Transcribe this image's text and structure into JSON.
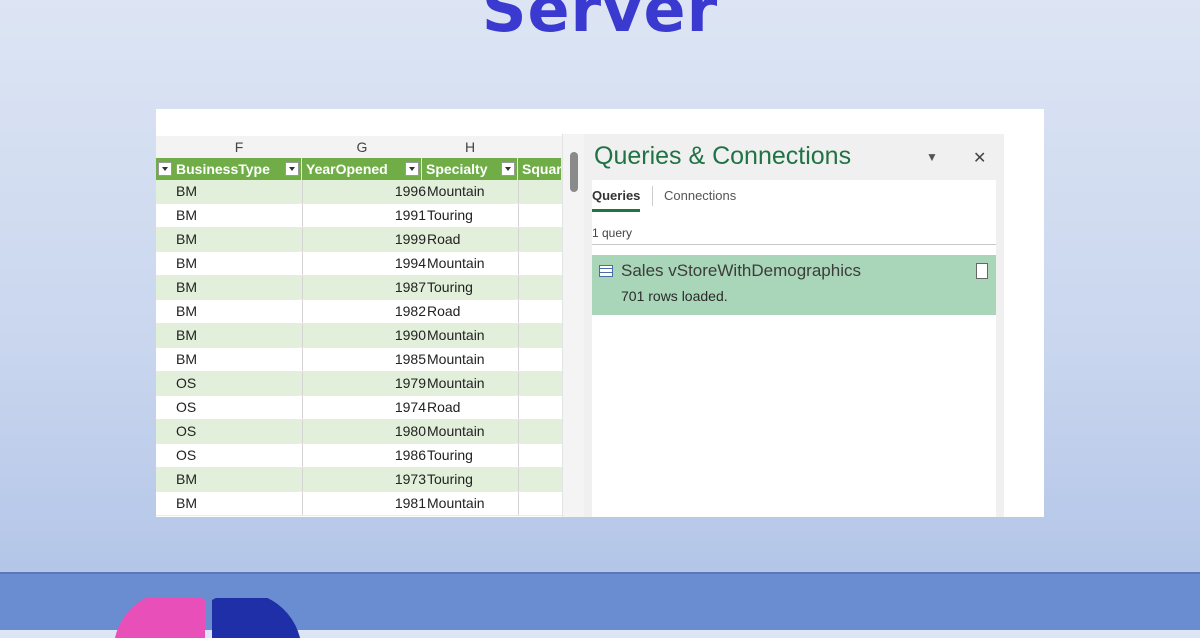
{
  "page": {
    "title": "Server"
  },
  "spreadsheet": {
    "column_letters": [
      "F",
      "G",
      "H"
    ],
    "headers": [
      "BusinessType",
      "YearOpened",
      "Specialty",
      "Squar"
    ],
    "rows": [
      {
        "type": "BM",
        "year": "1996",
        "specialty": "Mountain"
      },
      {
        "type": "BM",
        "year": "1991",
        "specialty": "Touring"
      },
      {
        "type": "BM",
        "year": "1999",
        "specialty": "Road"
      },
      {
        "type": "BM",
        "year": "1994",
        "specialty": "Mountain"
      },
      {
        "type": "BM",
        "year": "1987",
        "specialty": "Touring"
      },
      {
        "type": "BM",
        "year": "1982",
        "specialty": "Road"
      },
      {
        "type": "BM",
        "year": "1990",
        "specialty": "Mountain"
      },
      {
        "type": "BM",
        "year": "1985",
        "specialty": "Mountain"
      },
      {
        "type": "OS",
        "year": "1979",
        "specialty": "Mountain"
      },
      {
        "type": "OS",
        "year": "1974",
        "specialty": "Road"
      },
      {
        "type": "OS",
        "year": "1980",
        "specialty": "Mountain"
      },
      {
        "type": "OS",
        "year": "1986",
        "specialty": "Touring"
      },
      {
        "type": "BM",
        "year": "1973",
        "specialty": "Touring"
      },
      {
        "type": "BM",
        "year": "1981",
        "specialty": "Mountain"
      }
    ]
  },
  "queries_pane": {
    "title": "Queries & Connections",
    "tabs": [
      "Queries",
      "Connections"
    ],
    "count": "1 query",
    "query": {
      "name": "Sales vStoreWithDemographics",
      "status": "701 rows loaded."
    }
  },
  "colors": {
    "title": "#3a3ad0",
    "table_header": "#70ad47",
    "band_stripe": "#e2efda",
    "query_selected": "#a9d6b8",
    "footer": "#6a8cd0"
  }
}
